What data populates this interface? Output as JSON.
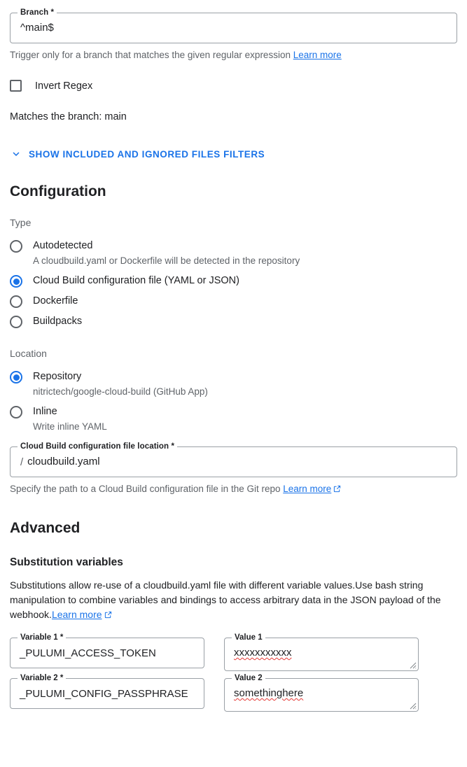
{
  "clipped_top": {
    "text": ""
  },
  "branch": {
    "legend": "Branch *",
    "value": "^main$",
    "hint_text": "Trigger only for a branch that matches the given regular expression",
    "hint_link": "Learn more"
  },
  "invert_regex": {
    "label": "Invert Regex",
    "checked": false
  },
  "match_status": "Matches the branch: main",
  "files_filter": {
    "label": "SHOW INCLUDED AND IGNORED FILES FILTERS",
    "icon": "chevron-down-icon",
    "color": "#1a73e8"
  },
  "configuration": {
    "heading": "Configuration",
    "type_group_label": "Type",
    "type_options": [
      {
        "label": "Autodetected",
        "description": "A cloudbuild.yaml or Dockerfile will be detected in the repository",
        "selected": false
      },
      {
        "label": "Cloud Build configuration file (YAML or JSON)",
        "description": "",
        "selected": true
      },
      {
        "label": "Dockerfile",
        "description": "",
        "selected": false
      },
      {
        "label": "Buildpacks",
        "description": "",
        "selected": false
      }
    ],
    "location_group_label": "Location",
    "location_options": [
      {
        "label": "Repository",
        "description": "nitrictech/google-cloud-build (GitHub App)",
        "selected": true
      },
      {
        "label": "Inline",
        "description": "Write inline YAML",
        "selected": false
      }
    ],
    "file_location": {
      "legend": "Cloud Build configuration file location *",
      "prefix": "/",
      "value": "cloudbuild.yaml",
      "hint_text": "Specify the path to a Cloud Build configuration file in the Git repo",
      "hint_link": "Learn more"
    }
  },
  "advanced": {
    "heading": "Advanced",
    "substitution": {
      "heading": "Substitution variables",
      "description": "Substitutions allow re-use of a cloudbuild.yaml file with different variable values.Use bash string manipulation to combine variables and bindings to access arbitrary data in the JSON payload of the webhook.",
      "description_link": "Learn more",
      "rows": [
        {
          "variable_legend": "Variable 1 *",
          "variable_value": "_PULUMI_ACCESS_TOKEN",
          "value_legend": "Value 1",
          "value_value": "xxxxxxxxxxx"
        },
        {
          "variable_legend": "Variable 2 *",
          "variable_value": "_PULUMI_CONFIG_PASSPHRASE",
          "value_legend": "Value 2",
          "value_value": "somethinghere"
        }
      ]
    }
  }
}
